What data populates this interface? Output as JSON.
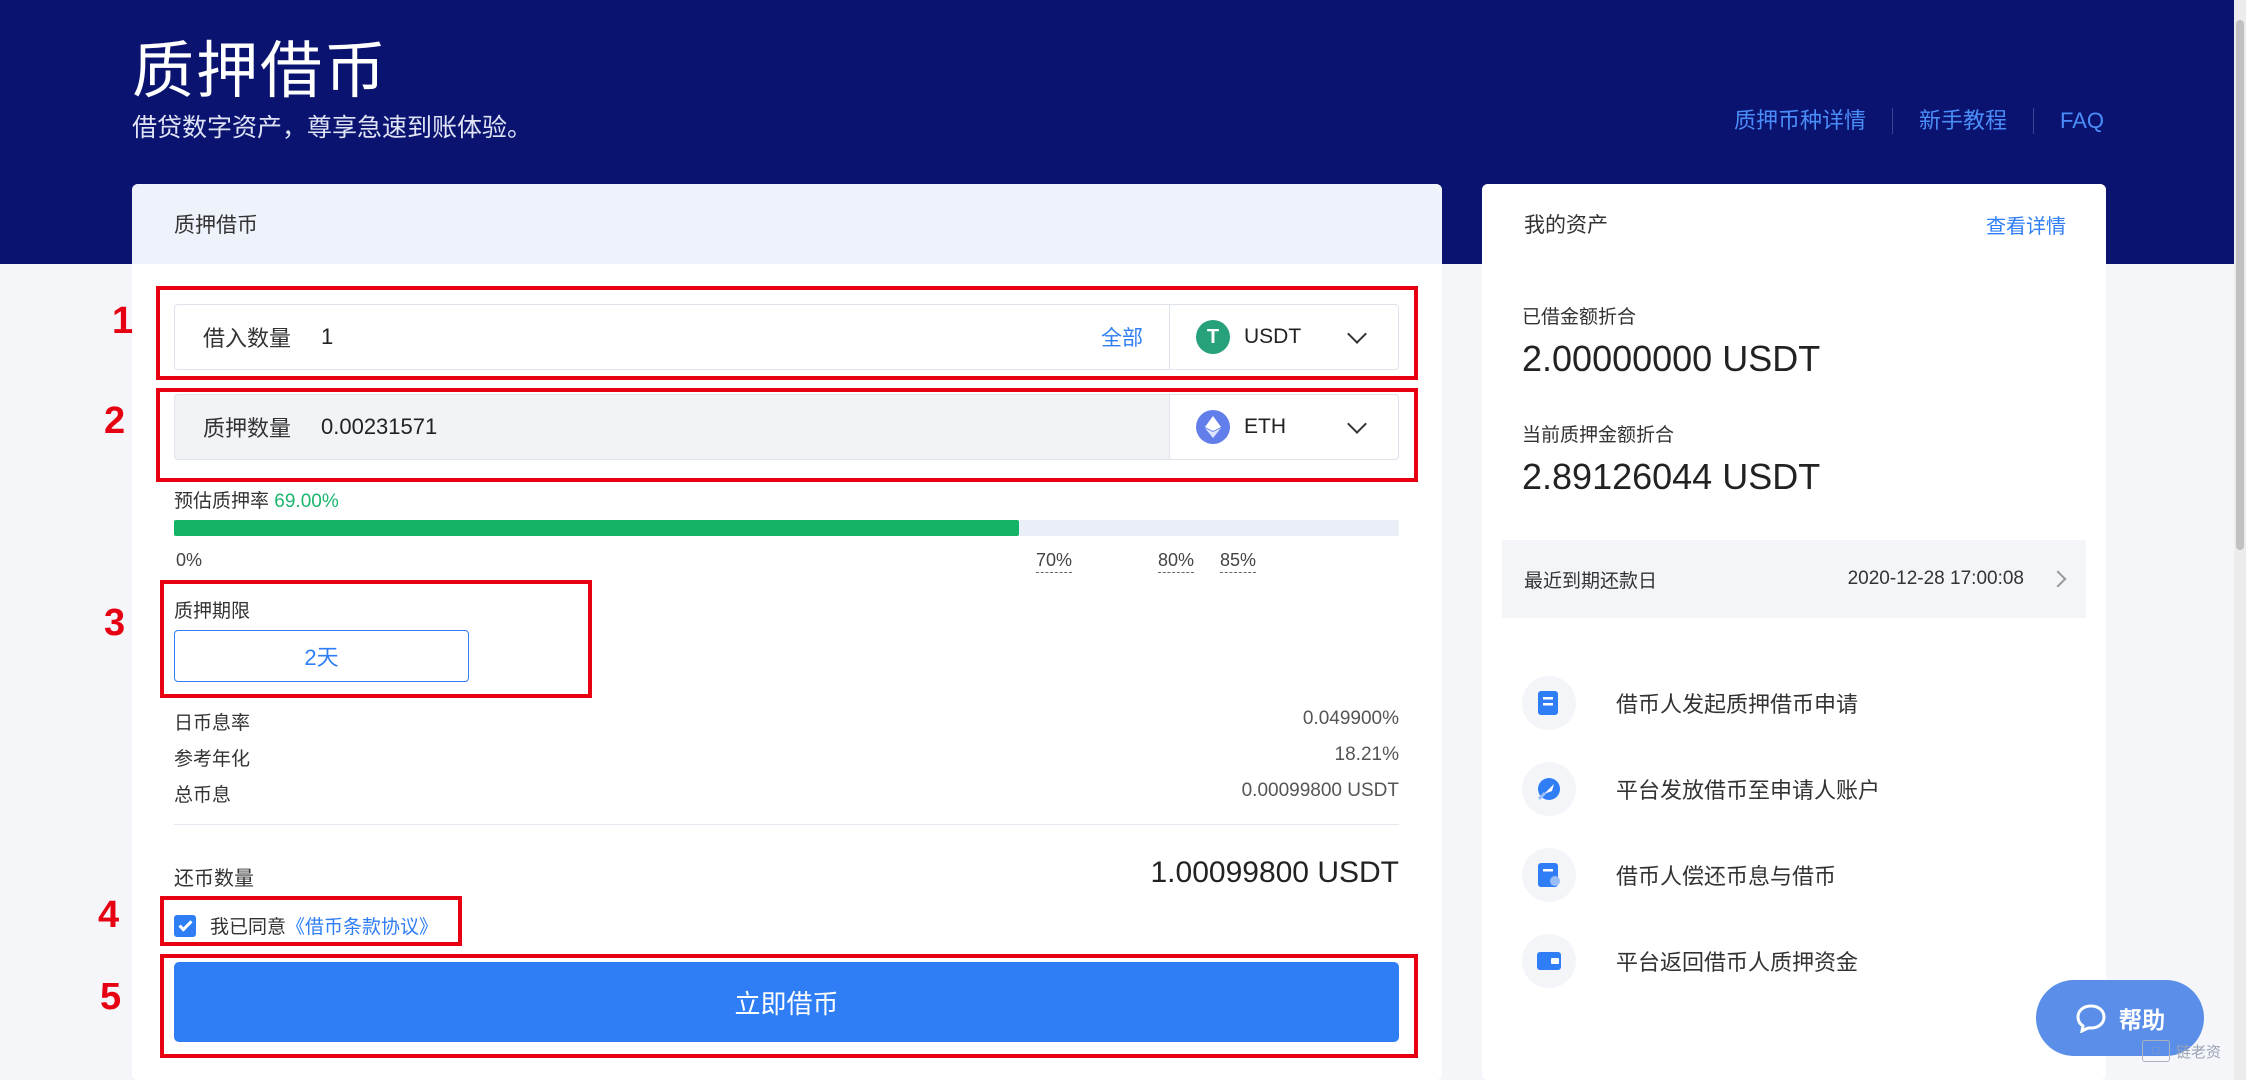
{
  "header": {
    "title": "质押借币",
    "subtitle": "借贷数字资产，尊享急速到账体验。",
    "links": [
      "质押币种详情",
      "新手教程",
      "FAQ"
    ]
  },
  "borrow_card": {
    "title": "质押借币",
    "borrow_row": {
      "label": "借入数量",
      "value": "1",
      "all_label": "全部",
      "coin": "USDT",
      "coin_icon": "usdt-icon"
    },
    "pledge_row": {
      "label": "质押数量",
      "value": "0.00231571",
      "coin": "ETH",
      "coin_icon": "eth-icon"
    },
    "rate": {
      "label": "预估质押率",
      "value": "69.00%",
      "fill_percent": 69,
      "ticks": [
        "0%",
        "70%",
        "80%",
        "85%"
      ]
    },
    "term": {
      "label": "质押期限",
      "value": "2天"
    },
    "info": [
      {
        "label": "日币息率",
        "value": "0.049900%"
      },
      {
        "label": "参考年化",
        "value": "18.21%"
      },
      {
        "label": "总币息",
        "value": "0.00099800 USDT"
      }
    ],
    "repay": {
      "label": "还币数量",
      "value": "1.00099800 USDT"
    },
    "agreement": {
      "text": "我已同意",
      "link": "《借币条款协议》",
      "checked": true
    },
    "submit_label": "立即借币"
  },
  "annotations": [
    "1",
    "2",
    "3",
    "4",
    "5"
  ],
  "assets_card": {
    "title": "我的资产",
    "detail_link": "查看详情",
    "borrowed_label": "已借金额折合",
    "borrowed_value": "2.00000000 USDT",
    "pledged_label": "当前质押金额折合",
    "pledged_value": "2.89126044 USDT",
    "due": {
      "label": "最近到期还款日",
      "date": "2020-12-28 17:00:08"
    },
    "steps": [
      {
        "text": "借币人发起质押借币申请",
        "icon": "document-icon"
      },
      {
        "text": "平台发放借币至申请人账户",
        "icon": "rocket-icon"
      },
      {
        "text": "借币人偿还币息与借币",
        "icon": "repay-icon"
      },
      {
        "text": "平台返回借币人质押资金",
        "icon": "wallet-icon"
      }
    ]
  },
  "help": {
    "label": "帮助"
  },
  "watermark": {
    "text": "链老资"
  },
  "colors": {
    "hero": "#0a1470",
    "accent": "#2f7ef5",
    "progress": "#14b366",
    "annotation": "#e60012"
  }
}
